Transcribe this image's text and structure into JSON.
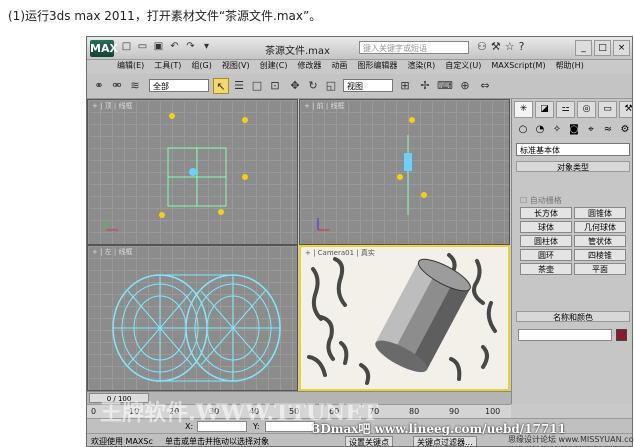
{
  "caption": "(1)运行3ds max 2011，打开素材文件“茶源文件.max”。",
  "window": {
    "logo": "MAX",
    "title": "茶源文件.max",
    "search_placeholder": "键入关键字或短语",
    "quick_access": [
      "新建",
      "打开",
      "保存",
      "撤销",
      "重做"
    ],
    "controls": [
      "_",
      "□",
      "×"
    ]
  },
  "menu": [
    "编辑(E)",
    "工具(T)",
    "组(G)",
    "视图(V)",
    "创建(C)",
    "修改器",
    "动画",
    "图形编辑器",
    "渲染(R)",
    "自定义(U)",
    "MAXScript(M)",
    "帮助(H)"
  ],
  "toolbar": {
    "filter": "全部",
    "refcoord": "视图"
  },
  "viewports": {
    "top": "+ | 顶 | 线框",
    "front": "+ | 前 | 线框",
    "left": "+ | 左 | 线框",
    "persp": "+ | Camera01 | 真实"
  },
  "panel": {
    "category": "标准基本体",
    "rollout_object": "对象类型",
    "autogrid": "自动栅格",
    "buttons": [
      "长方体",
      "圆锥体",
      "球体",
      "几何球体",
      "圆柱体",
      "管状体",
      "圆环",
      "四棱锥",
      "茶壶",
      "平面"
    ],
    "rollout_name": "名称和颜色",
    "swatch_color": "#8a1a2b"
  },
  "timeline": {
    "frame": "0 / 100",
    "ticks": [
      "0",
      "10",
      "20",
      "30",
      "40",
      "50",
      "60",
      "70",
      "80",
      "90",
      "100"
    ]
  },
  "status": {
    "x_label": "X:",
    "y_label": "Y:",
    "setkey": "设置关键点",
    "welcome": "欢迎使用 MAXSc",
    "prompt": "单击或单击并拖动以选择对象",
    "keyfilter": "关键点过滤器..."
  },
  "watermarks": {
    "bottom_left": "王牌软件.WWW.TTUNET",
    "bottom_center": "3Dmax吧 www.lineeg.com/uebd/17711",
    "bottom_right": "思缘设计论坛 www.MISSYUAN.com"
  }
}
